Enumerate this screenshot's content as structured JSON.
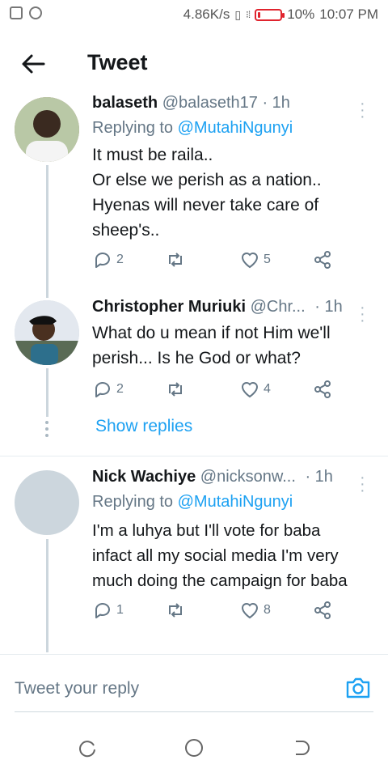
{
  "status": {
    "speed": "4.86K/s",
    "battery": "10%",
    "time": "10:07 PM",
    "battery_level": 0.1
  },
  "header": {
    "title": "Tweet"
  },
  "colors": {
    "accent": "#1da1f2",
    "text": "#14171a",
    "muted": "#657786"
  },
  "tweets": [
    {
      "name": "balaseth",
      "handle": "@balaseth17",
      "time": "· 1h",
      "replying_prefix": "Replying to ",
      "replying_to": "@MutahiNgunyi",
      "lines": [
        "It must be raila..",
        "Or else we perish as a nation..",
        "Hyenas will never take care of",
        "sheep's.."
      ],
      "replies": "2",
      "retweets": "",
      "likes": "5"
    },
    {
      "name": "Christopher Muriuki",
      "handle": "@Chr...",
      "time": "· 1h",
      "lines": [
        "What do u mean if not Him we'll",
        "perish... Is he God or what?"
      ],
      "replies": "2",
      "retweets": "",
      "likes": "4",
      "show_replies": "Show replies"
    },
    {
      "name": "Nick Wachiye",
      "handle": "@nicksonw...",
      "time": "· 1h",
      "replying_prefix": "Replying to ",
      "replying_to": "@MutahiNgunyi",
      "lines": [
        "I'm a luhya but I'll vote for baba",
        "infact all my social media I'm very",
        "much doing the campaign for baba"
      ],
      "replies": "1",
      "retweets": "",
      "likes": "8"
    }
  ],
  "composer": {
    "placeholder": "Tweet your reply"
  },
  "icons": [
    "back-arrow-icon",
    "reply-icon",
    "retweet-icon",
    "like-icon",
    "share-icon",
    "more-icon",
    "camera-icon",
    "recent-apps-icon",
    "home-icon",
    "back-icon"
  ]
}
